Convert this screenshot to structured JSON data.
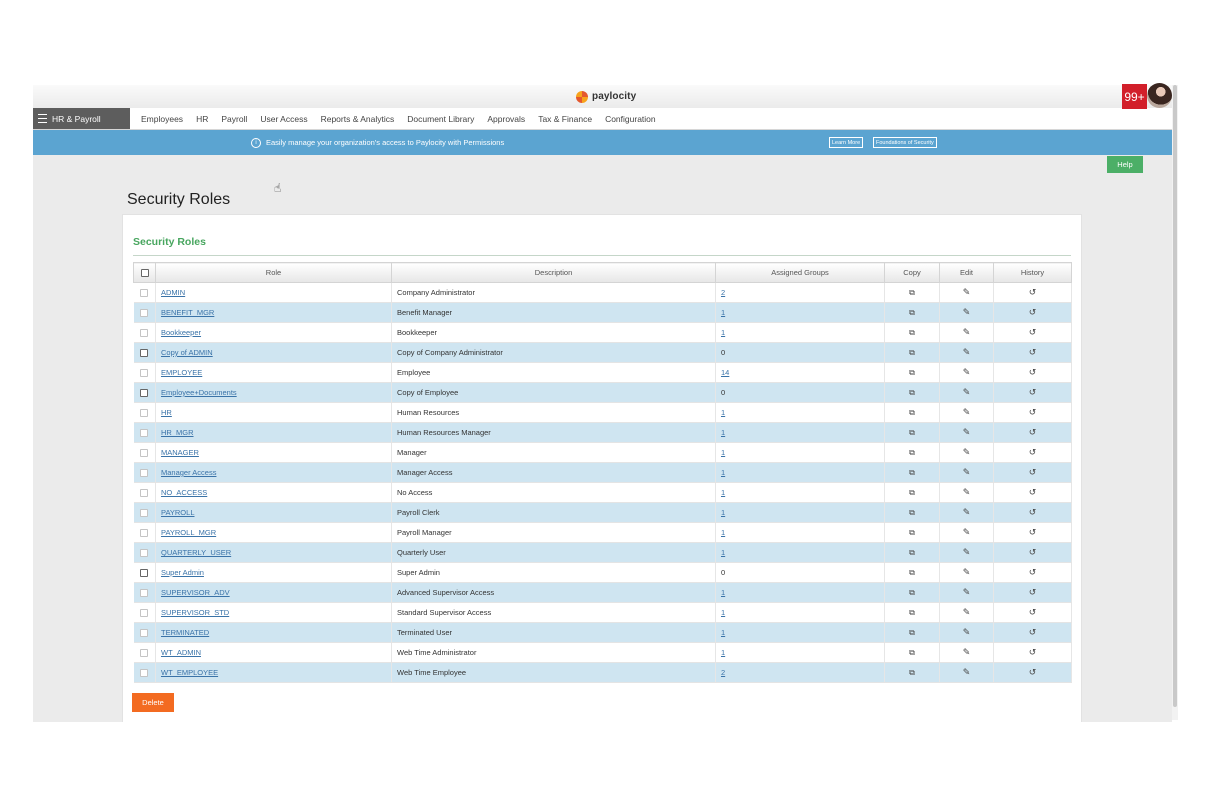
{
  "logo": {
    "text": "paylocity"
  },
  "product_menu": {
    "label": "HR & Payroll"
  },
  "nav": {
    "items": [
      "Employees",
      "HR",
      "Payroll",
      "User Access",
      "Reports & Analytics",
      "Document Library",
      "Approvals",
      "Tax & Finance",
      "Configuration"
    ]
  },
  "banner": {
    "message": "Easily manage your organization's access to Paylocity with Permissions",
    "learn_more": "Learn More",
    "foundations": "Foundations of Security"
  },
  "help_label": "Help",
  "notifications": {
    "count": "99+"
  },
  "page_title": "Security Roles",
  "card": {
    "title": "Security Roles",
    "columns": {
      "role": "Role",
      "description": "Description",
      "assigned_groups": "Assigned Groups",
      "copy": "Copy",
      "edit": "Edit",
      "history": "History"
    },
    "rows": [
      {
        "role": "ADMIN",
        "description": "Company Administrator",
        "groups": "2",
        "groups_link": true,
        "checkbox_enabled": false
      },
      {
        "role": "BENEFIT_MGR",
        "description": "Benefit Manager",
        "groups": "1",
        "groups_link": true,
        "checkbox_enabled": false
      },
      {
        "role": "Bookkeeper",
        "description": "Bookkeeper",
        "groups": "1",
        "groups_link": true,
        "checkbox_enabled": false
      },
      {
        "role": "Copy of ADMIN",
        "description": "Copy of Company Administrator",
        "groups": "0",
        "groups_link": false,
        "checkbox_enabled": true
      },
      {
        "role": "EMPLOYEE",
        "description": "Employee",
        "groups": "14",
        "groups_link": true,
        "checkbox_enabled": false
      },
      {
        "role": "Employee+Documents",
        "description": "Copy of Employee",
        "groups": "0",
        "groups_link": false,
        "checkbox_enabled": true
      },
      {
        "role": "HR",
        "description": "Human Resources",
        "groups": "1",
        "groups_link": true,
        "checkbox_enabled": false
      },
      {
        "role": "HR_MGR",
        "description": "Human Resources Manager",
        "groups": "1",
        "groups_link": true,
        "checkbox_enabled": false
      },
      {
        "role": "MANAGER",
        "description": "Manager",
        "groups": "1",
        "groups_link": true,
        "checkbox_enabled": false
      },
      {
        "role": "Manager Access",
        "description": "Manager Access",
        "groups": "1",
        "groups_link": true,
        "checkbox_enabled": false
      },
      {
        "role": "NO_ACCESS",
        "description": "No Access",
        "groups": "1",
        "groups_link": true,
        "checkbox_enabled": false
      },
      {
        "role": "PAYROLL",
        "description": "Payroll Clerk",
        "groups": "1",
        "groups_link": true,
        "checkbox_enabled": false
      },
      {
        "role": "PAYROLL_MGR",
        "description": "Payroll Manager",
        "groups": "1",
        "groups_link": true,
        "checkbox_enabled": false
      },
      {
        "role": "QUARTERLY_USER",
        "description": "Quarterly User",
        "groups": "1",
        "groups_link": true,
        "checkbox_enabled": false
      },
      {
        "role": "Super Admin",
        "description": "Super Admin",
        "groups": "0",
        "groups_link": false,
        "checkbox_enabled": true
      },
      {
        "role": "SUPERVISOR_ADV",
        "description": "Advanced Supervisor Access",
        "groups": "1",
        "groups_link": true,
        "checkbox_enabled": false
      },
      {
        "role": "SUPERVISOR_STD",
        "description": "Standard Supervisor Access",
        "groups": "1",
        "groups_link": true,
        "checkbox_enabled": false
      },
      {
        "role": "TERMINATED",
        "description": "Terminated User",
        "groups": "1",
        "groups_link": true,
        "checkbox_enabled": false
      },
      {
        "role": "WT_ADMIN",
        "description": "Web Time Administrator",
        "groups": "1",
        "groups_link": true,
        "checkbox_enabled": false
      },
      {
        "role": "WT_EMPLOYEE",
        "description": "Web Time Employee",
        "groups": "2",
        "groups_link": true,
        "checkbox_enabled": false
      }
    ]
  },
  "delete_label": "Delete",
  "icons": {
    "copy": "copy-icon",
    "edit": "pencil-icon",
    "history": "history-icon",
    "info": "info-icon",
    "menu": "hamburger-icon"
  },
  "colors": {
    "banner": "#5ba4d1",
    "accent_green": "#48a65f",
    "help": "#4caf67",
    "delete": "#f36b21",
    "row_alt": "#cfe5f1",
    "link": "#3a73a8",
    "badge": "#d21f2a"
  }
}
